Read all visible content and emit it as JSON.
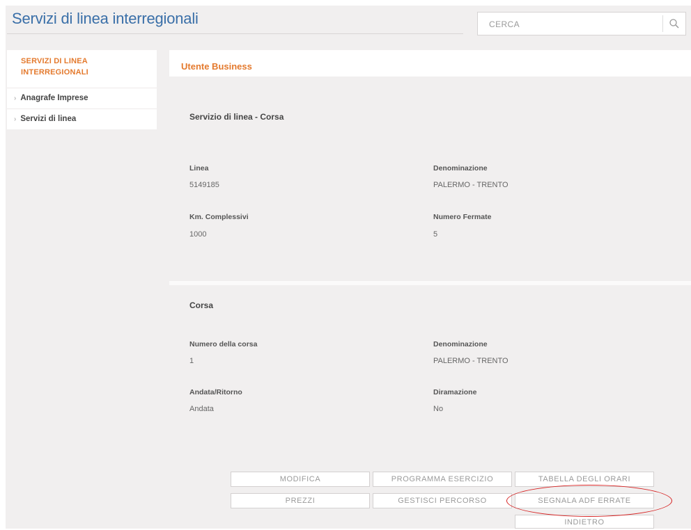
{
  "header": {
    "title": "Servizi di linea interregionali",
    "search_placeholder": "CERCA"
  },
  "sidebar": {
    "heading_line1": "SERVIZI DI LINEA",
    "heading_line2": "INTERREGIONALI",
    "items": [
      {
        "label": "Anagrafe Imprese"
      },
      {
        "label": "Servizi di linea"
      }
    ]
  },
  "panel": {
    "tab_label": "Utente Business"
  },
  "servizio": {
    "title": "Servizio di linea - Corsa",
    "linea_label": "Linea",
    "linea_value": "5149185",
    "denominazione_label": "Denominazione",
    "denominazione_value": "PALERMO - TRENTO",
    "km_label": "Km. Complessivi",
    "km_value": "1000",
    "fermate_label": "Numero Fermate",
    "fermate_value": "5"
  },
  "corsa": {
    "title": "Corsa",
    "numero_label": "Numero della corsa",
    "numero_value": "1",
    "denominazione_label": "Denominazione",
    "denominazione_value": "PALERMO - TRENTO",
    "andata_label": "Andata/Ritorno",
    "andata_value": "Andata",
    "diramazione_label": "Diramazione",
    "diramazione_value": "No"
  },
  "buttons": {
    "modifica": "MODIFICA",
    "programma": "PROGRAMMA ESERCIZIO",
    "tabella": "TABELLA DEGLI ORARI",
    "prezzi": "PREZZI",
    "gestisci": "GESTISCI PERCORSO",
    "segnala": "SEGNALA ADF ERRATE",
    "indietro": "INDIETRO"
  },
  "colors": {
    "title_blue": "#3a6fa8",
    "accent_orange": "#e47a2e",
    "highlight_red": "#d62020"
  }
}
